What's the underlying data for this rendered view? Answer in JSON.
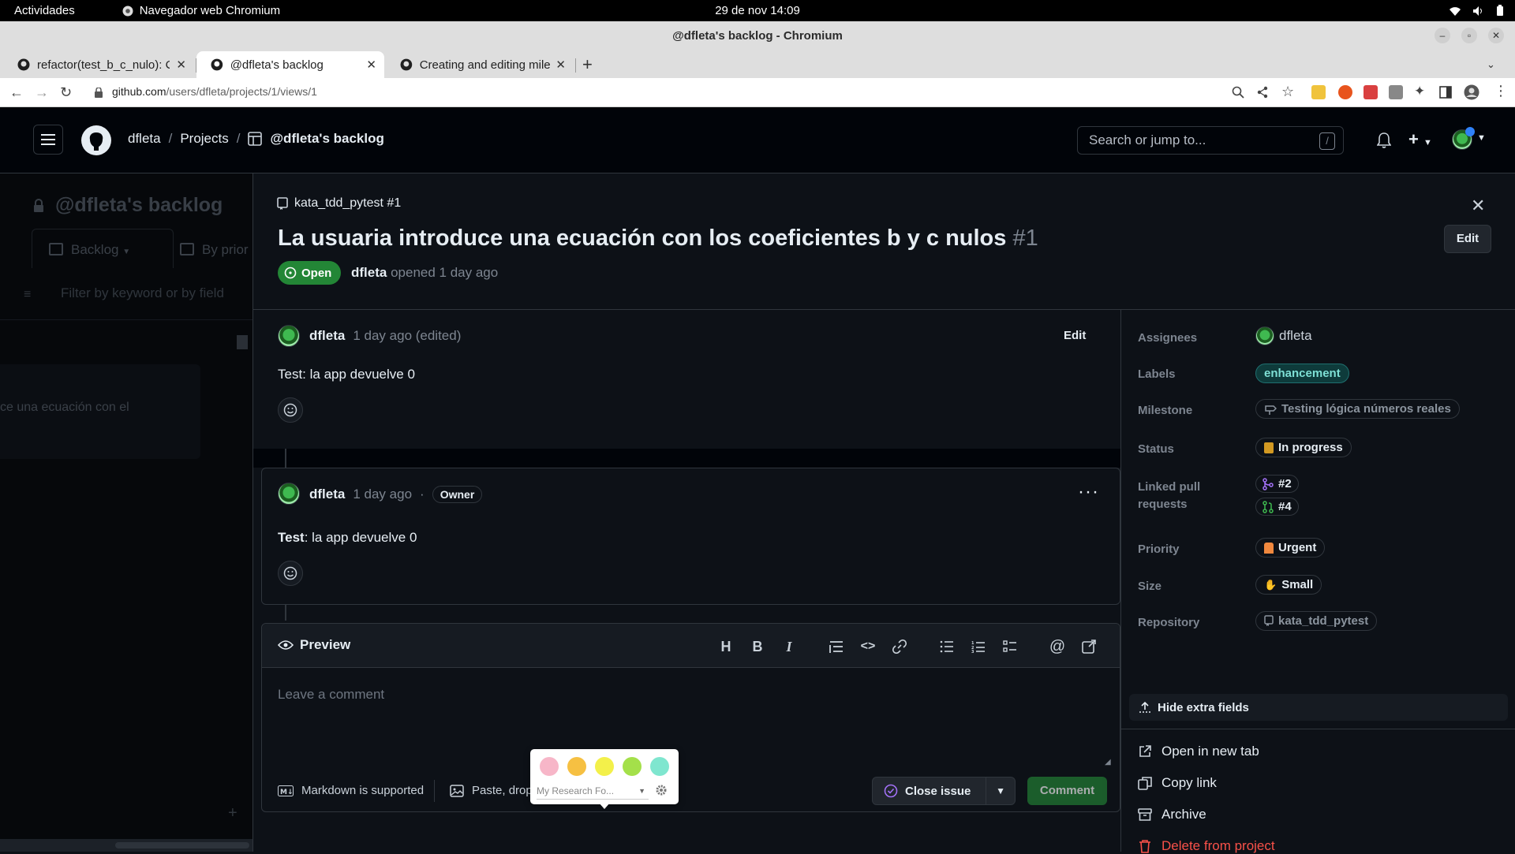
{
  "os": {
    "activities": "Actividades",
    "app_name": "Navegador web Chromium",
    "clock": "29 de nov  14:09"
  },
  "window": {
    "title": "@dfleta's backlog - Chromium"
  },
  "tabs": [
    {
      "label": "refactor(test_b_c_nulo): C"
    },
    {
      "label": "@dfleta's backlog"
    },
    {
      "label": "Creating and editing mile"
    }
  ],
  "address": {
    "host": "github.com",
    "path": "/users/dfleta/projects/1/views/1"
  },
  "gh_header": {
    "user": "dfleta",
    "projects": "Projects",
    "project": "@dfleta's backlog",
    "search_placeholder": "Search or jump to...",
    "search_shortcut": "/"
  },
  "board": {
    "title": "@dfleta's backlog",
    "views": [
      "Backlog",
      "By prior"
    ],
    "filter_placeholder": "Filter by keyword or by field",
    "card_text": "ce una ecuación con el"
  },
  "issue": {
    "repo_ref": "kata_tdd_pytest #1",
    "title": "La usuaria introduce una ecuación con los coeficientes b y c nulos",
    "number": "#1",
    "edit_label": "Edit",
    "state": "Open",
    "author": "dfleta",
    "opened_text": "opened 1 day ago"
  },
  "body_comment": {
    "author": "dfleta",
    "time": "1 day ago (edited)",
    "edit_label": "Edit",
    "text": "Test: la app devuelve 0"
  },
  "comment": {
    "author": "dfleta",
    "time": "1 day ago",
    "dot": "·",
    "role": "Owner",
    "text_bold": "Test",
    "text_rest": ": la app devuelve 0",
    "menu": "···"
  },
  "editor": {
    "preview_label": "Preview",
    "placeholder": "Leave a comment",
    "markdown_note": "Markdown is supported",
    "paste_note": "Paste, drop",
    "close_issue": "Close issue",
    "comment_button": "Comment"
  },
  "popup": {
    "swatch_colors": [
      "#f7b6c8",
      "#f6c042",
      "#f3f04a",
      "#a4e04a",
      "#7fe6cf"
    ],
    "select_label": "My Research Fo..."
  },
  "fields": {
    "assignees_label": "Assignees",
    "assignee": "dfleta",
    "labels_label": "Labels",
    "label": "enhancement",
    "milestone_label": "Milestone",
    "milestone": "Testing lógica números reales",
    "status_label": "Status",
    "status": "In progress",
    "linked_label_1": "Linked pull",
    "linked_label_2": "requests",
    "pr1": "#2",
    "pr2": "#4",
    "priority_label": "Priority",
    "priority": "Urgent",
    "size_label": "Size",
    "size": "Small",
    "repository_label": "Repository",
    "repository": "kata_tdd_pytest",
    "hide_extra": "Hide extra fields"
  },
  "actions": {
    "open_new_tab": "Open in new tab",
    "copy_link": "Copy link",
    "archive": "Archive",
    "delete": "Delete from project"
  },
  "colors": {
    "open_green": "#238636",
    "danger_red": "#f85149",
    "bg": "#0d1117"
  }
}
